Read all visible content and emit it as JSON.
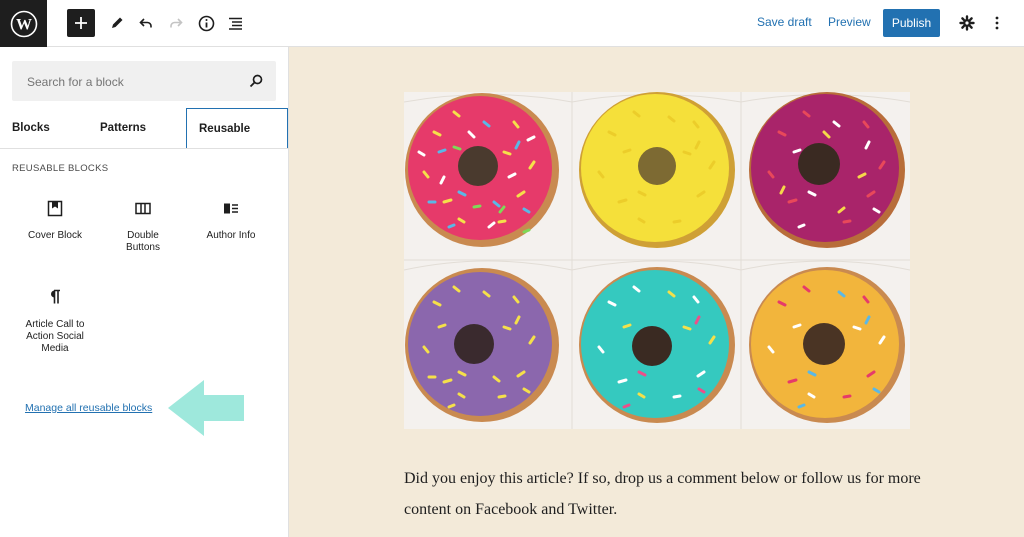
{
  "toolbar": {
    "save_draft": "Save draft",
    "preview": "Preview",
    "publish": "Publish"
  },
  "inserter": {
    "search_placeholder": "Search for a block",
    "tabs": [
      {
        "label": "Blocks"
      },
      {
        "label": "Patterns"
      },
      {
        "label": "Reusable"
      }
    ],
    "active_tab": "Reusable",
    "section_title": "REUSABLE BLOCKS",
    "blocks": [
      {
        "label": "Cover Block",
        "icon": "cover-icon"
      },
      {
        "label": "Double Buttons",
        "icon": "columns-icon"
      },
      {
        "label": "Author Info",
        "icon": "media-text-icon"
      },
      {
        "label": "Article Call to Action Social Media",
        "icon": "paragraph-icon"
      }
    ],
    "manage_link": "Manage all reusable blocks"
  },
  "article": {
    "paragraph": "Did you enjoy this article? If so, drop us a comment below or follow us for more content on Facebook and Twitter."
  },
  "colors": {
    "accent": "#2271b1",
    "dark": "#1e1e1e",
    "canvas": "#f3ead9",
    "arrow": "#9ee8dc"
  }
}
